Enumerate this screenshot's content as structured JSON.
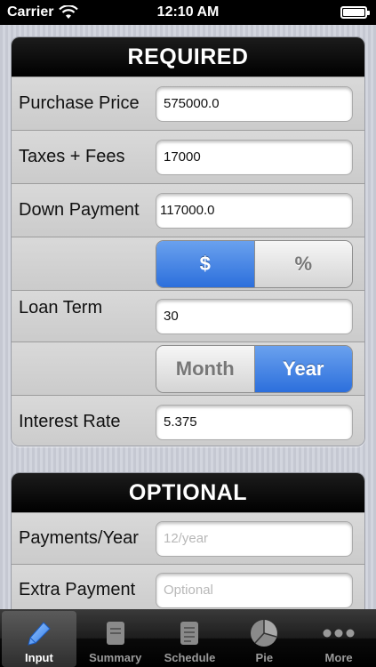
{
  "status_bar": {
    "carrier": "Carrier",
    "time": "12:10 AM"
  },
  "required": {
    "header": "REQUIRED",
    "purchase_price": {
      "label": "Purchase Price",
      "value": "575000.0"
    },
    "taxes_fees": {
      "label": "Taxes + Fees",
      "value": "17000"
    },
    "down_payment": {
      "label": "Down Payment",
      "value": "117000.0"
    },
    "down_payment_unit": {
      "options": [
        "$",
        "%"
      ],
      "selected": "$"
    },
    "loan_term": {
      "label": "Loan Term",
      "value": "30"
    },
    "loan_term_unit": {
      "options": [
        "Month",
        "Year"
      ],
      "selected": "Year"
    },
    "interest_rate": {
      "label": "Interest Rate",
      "value": "5.375"
    }
  },
  "optional": {
    "header": "OPTIONAL",
    "payments_per_year": {
      "label": "Payments/Year",
      "placeholder": "12/year"
    },
    "extra_payment": {
      "label": "Extra Payment",
      "placeholder": "Optional"
    }
  },
  "tab_bar": {
    "tabs": [
      {
        "label": "Input",
        "icon": "pencil-icon",
        "active": true
      },
      {
        "label": "Summary",
        "icon": "document-icon",
        "active": false
      },
      {
        "label": "Schedule",
        "icon": "list-document-icon",
        "active": false
      },
      {
        "label": "Pie",
        "icon": "pie-chart-icon",
        "active": false
      },
      {
        "label": "More",
        "icon": "more-dots-icon",
        "active": false
      }
    ]
  },
  "colors": {
    "accent": "#2c6fdc",
    "header_bg": "#000000",
    "tab_bar_bg": "#1d1d1d"
  }
}
